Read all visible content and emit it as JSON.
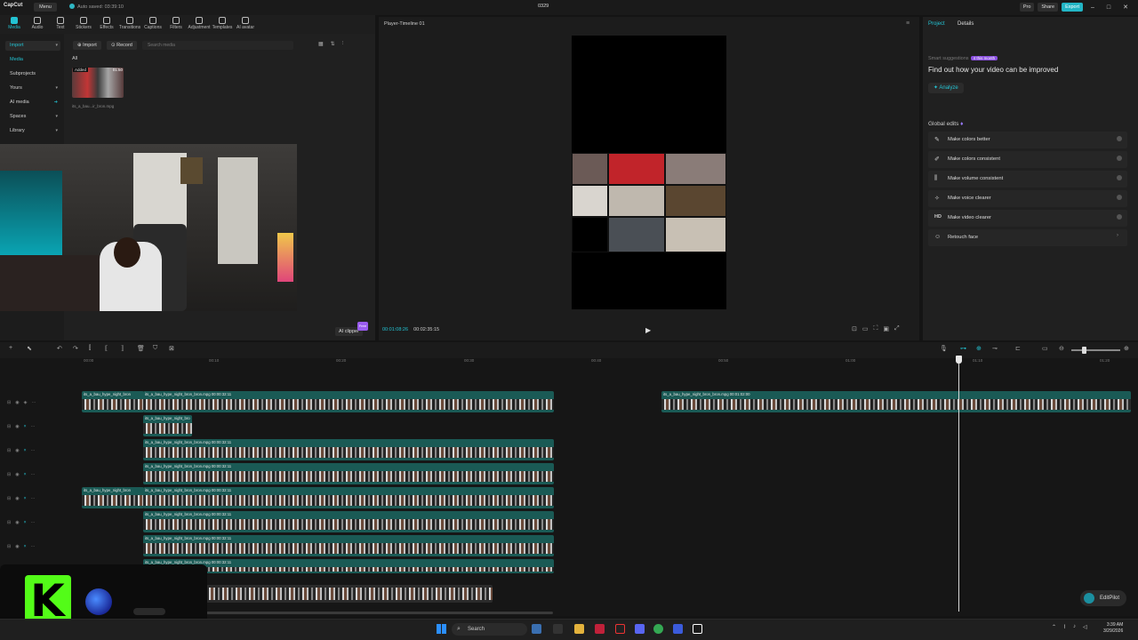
{
  "titlebar": {
    "app_name": "CapCut",
    "menu_label": "Menu",
    "autosave": "Auto saved: 03:39:10",
    "project_name": "0329",
    "pro_label": "Pro",
    "share_label": "Share",
    "export_label": "Export"
  },
  "toolbar": {
    "tools": [
      "Media",
      "Audio",
      "Text",
      "Stickers",
      "Effects",
      "Transitions",
      "Captions",
      "Filters",
      "Adjustment",
      "Templates",
      "AI avatar"
    ]
  },
  "leftnav": {
    "items": [
      "Import",
      "Media",
      "Subprojects",
      "Yours",
      "AI media",
      "Spaces",
      "Library"
    ]
  },
  "media": {
    "import_label": "Import",
    "record_label": "Record",
    "search_placeholder": "Search media",
    "all_label": "All",
    "thumb_badge": "Added",
    "thumb_duration": "01:50",
    "thumb_name": "its_a_bau...ir_bron.mpg",
    "ai_clipper_label": "AI clipper",
    "free_badge": "Free"
  },
  "player": {
    "title": "Player-Timeline 01",
    "current_time": "00:01:08:26",
    "total_time": "00:02:35:15"
  },
  "right": {
    "tab_project": "Project",
    "tab_details": "Details",
    "smart_label": "Smart suggestions",
    "smart_badge": "4 this month",
    "headline": "Find out how your video can be improved",
    "analyze_label": "Analyze",
    "global_label": "Global edits",
    "edits": [
      {
        "icon": "✎",
        "label": "Make colors better"
      },
      {
        "icon": "✐",
        "label": "Make colors consistent"
      },
      {
        "icon": "⫼",
        "label": "Make volume consistent"
      },
      {
        "icon": "✧",
        "label": "Make voice clearer"
      },
      {
        "icon": "HD",
        "label": "Make video clearer"
      },
      {
        "icon": "☺",
        "label": "Retouch face"
      }
    ]
  },
  "ruler": {
    "ticks": [
      "00:00",
      "00:10",
      "00:20",
      "00:30",
      "00:40",
      "00:50",
      "01:00",
      "01:10",
      "01:20"
    ]
  },
  "clips": {
    "names": [
      "its_a_bau_hype_night_bron",
      "its_a_bau_hype_night_bron_bron.mpg  00:00:32:11",
      "its_a_bau_hype_night_bron_bron.mpg  00:01:02:00",
      "its_a_bau_hype_night_bro"
    ]
  },
  "editpilot": {
    "label": "EditPilot"
  },
  "taskbar": {
    "search_label": "Search",
    "time": "3:39 AM",
    "date": "3/29/2026"
  },
  "colors": {
    "accent": "#23c3d3",
    "clip": "#1a5a55",
    "kick": "#53fc18",
    "export": "#22b5c5"
  }
}
